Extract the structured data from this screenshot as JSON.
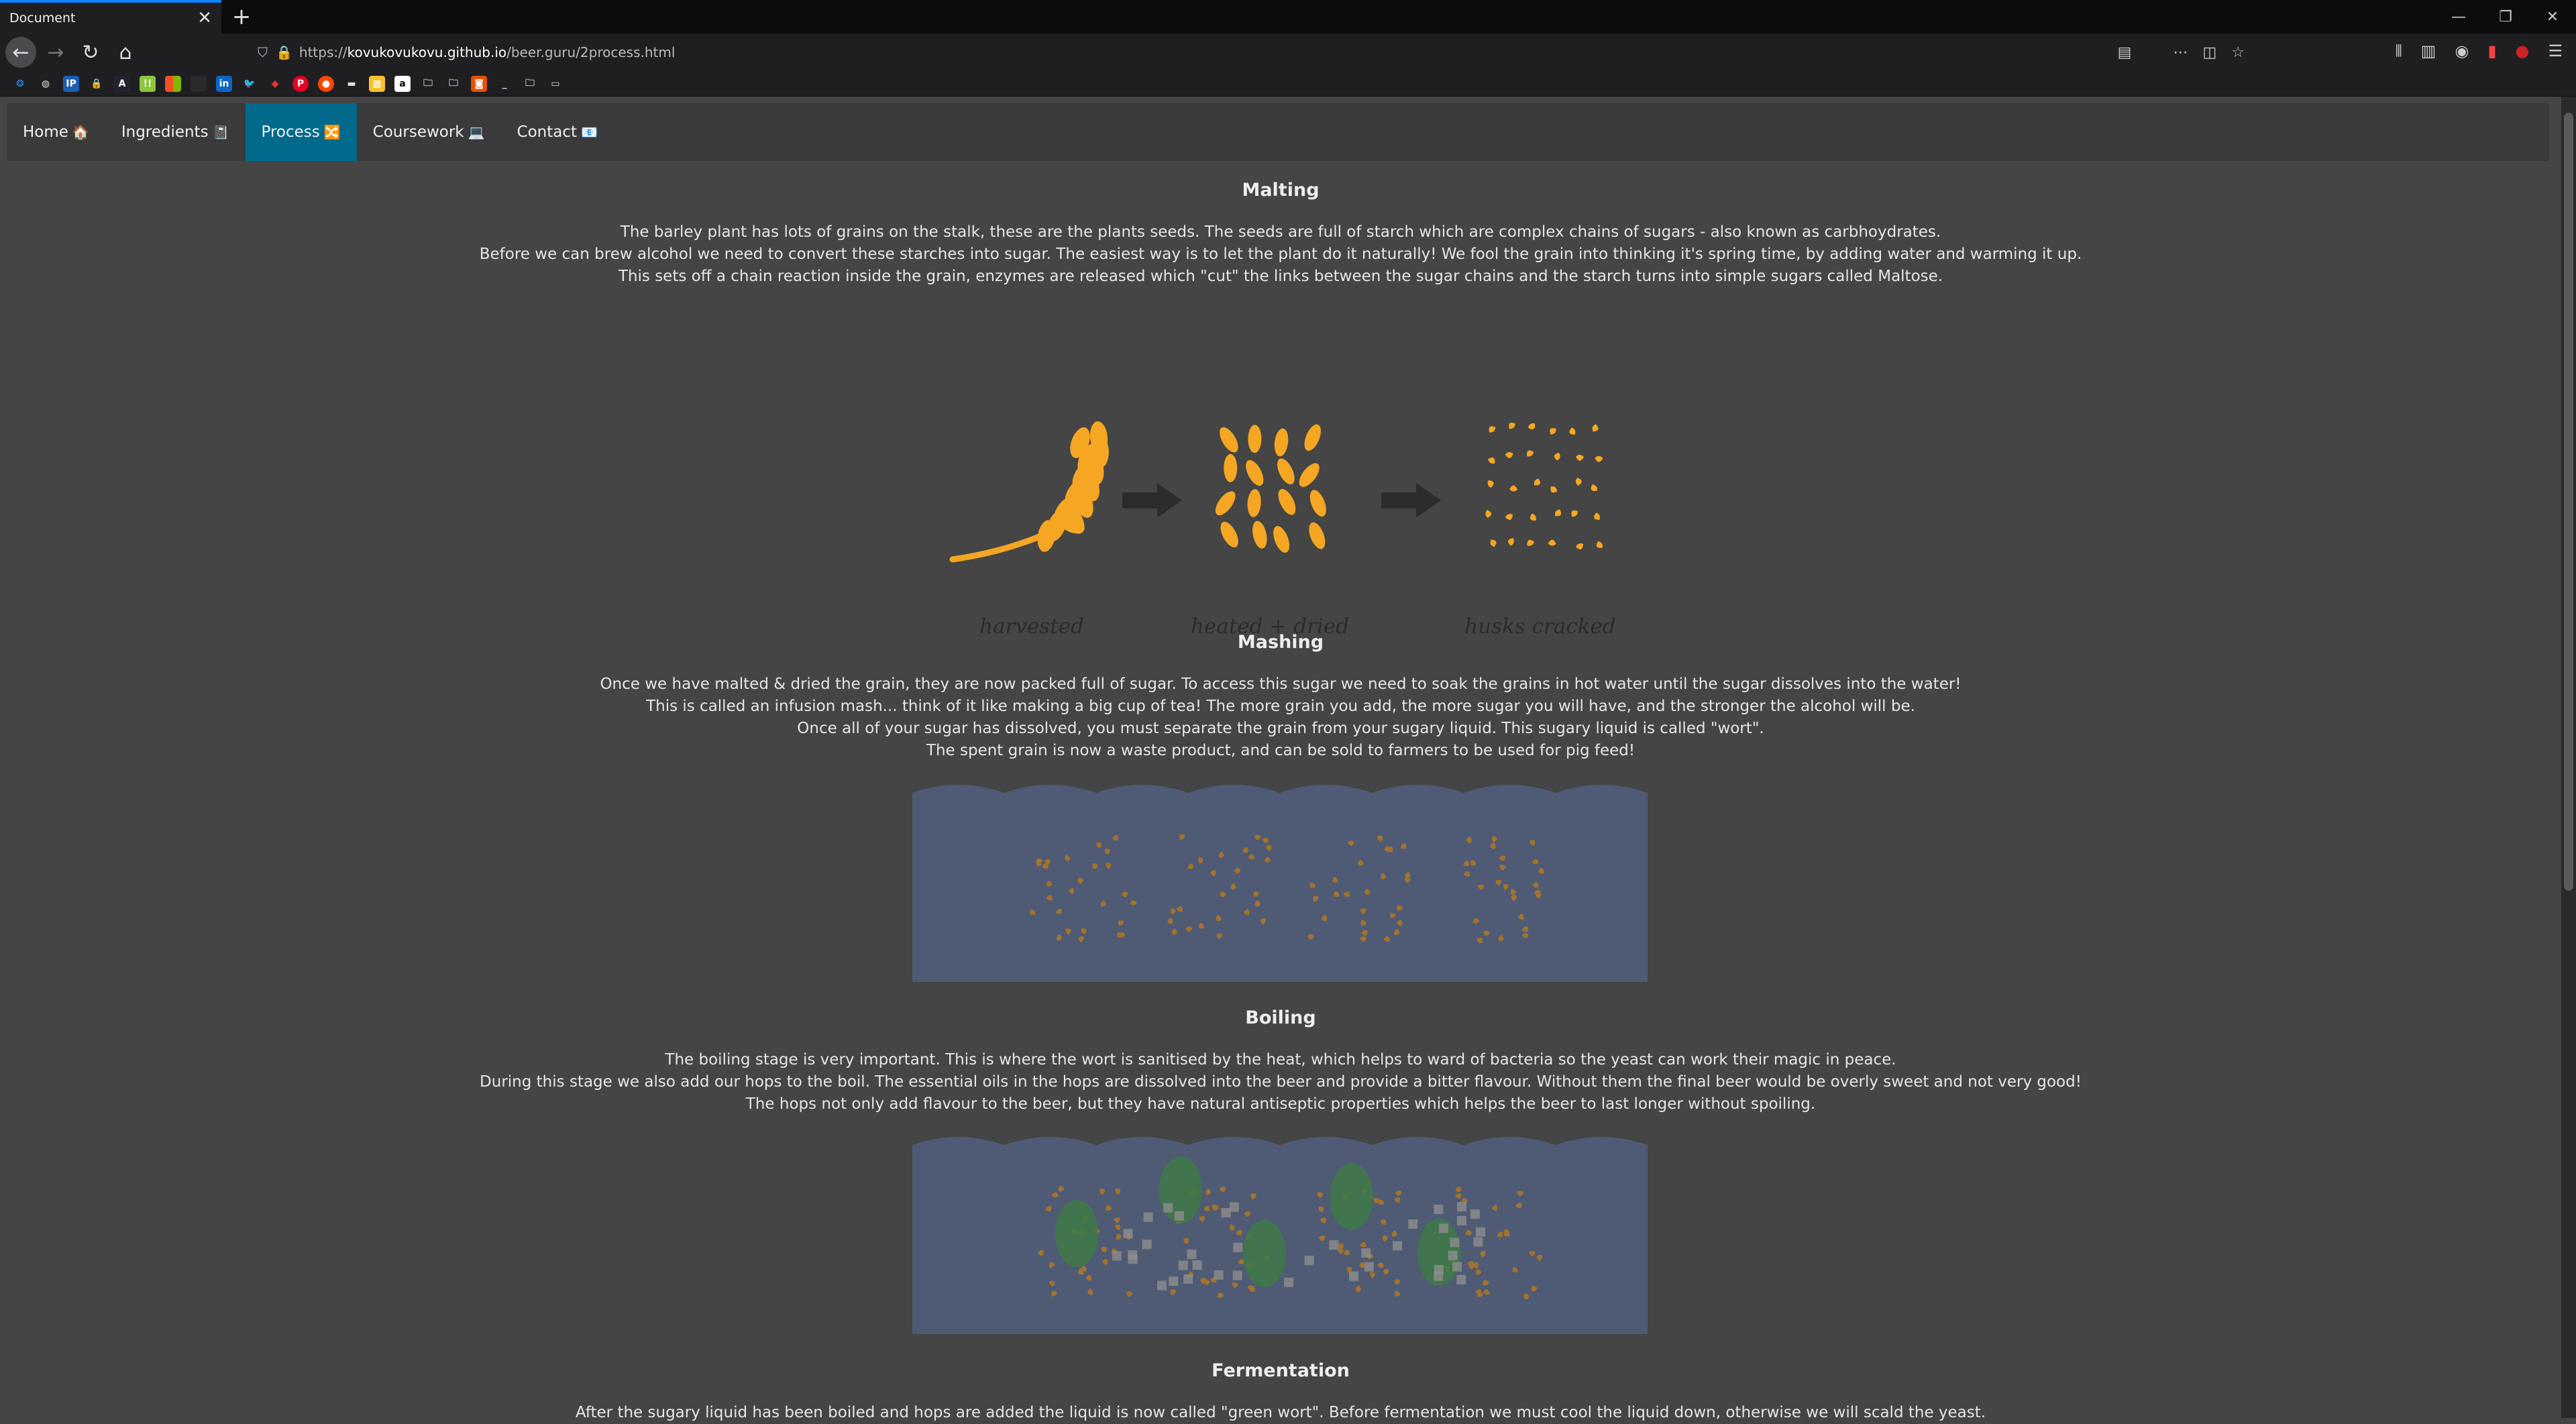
{
  "browser": {
    "tab_title": "Document",
    "url_prefix": "https://",
    "url_domain": "kovukovukovu.github.io",
    "url_path": "/beer.guru/2process.html"
  },
  "site_nav": {
    "items": [
      {
        "label": "Home",
        "emoji": "🏠"
      },
      {
        "label": "Ingredients",
        "emoji": "📓"
      },
      {
        "label": "Process",
        "emoji": "🔀"
      },
      {
        "label": "Coursework",
        "emoji": "💻"
      },
      {
        "label": "Contact",
        "emoji": "📧"
      }
    ],
    "active": "Process"
  },
  "sections": {
    "malting": {
      "title": "Malting",
      "lines": [
        "The barley plant has lots of grains on the stalk, these are the plants seeds. The seeds are full of starch which are complex chains of sugars - also known as carbhoydrates.",
        "Before we can brew alcohol we need to convert these starches into sugar. The easiest way is to let the plant do it naturally! We fool the grain into thinking it's spring time, by adding water and warming it up.",
        "This sets off a chain reaction inside the grain, enzymes are released which \"cut\" the links between the sugar chains and the starch turns into simple sugars called Maltose."
      ],
      "captions": [
        "harvested",
        "heated + dried",
        "husks cracked"
      ]
    },
    "mashing": {
      "title": "Mashing",
      "lines": [
        "Once we have malted & dried the grain, they are now packed full of sugar. To access this sugar we need to soak the grains in hot water until the sugar dissolves into the water!",
        "This is called an infusion mash... think of it like making a big cup of tea! The more grain you add, the more sugar you will have, and the stronger the alcohol will be.",
        "Once all of your sugar has dissolved, you must separate the grain from your sugary liquid. This sugary liquid is called \"wort\".",
        "The spent grain is now a waste product, and can be sold to farmers to be used for pig feed!"
      ]
    },
    "boiling": {
      "title": "Boiling",
      "lines": [
        "The boiling stage is very important. This is where the wort is sanitised by the heat, which helps to ward of bacteria so the yeast can work their magic in peace.",
        "During this stage we also add our hops to the boil. The essential oils in the hops are dissolved into the beer and provide a bitter flavour. Without them the final beer would be overly sweet and not very good!",
        "The hops not only add flavour to the beer, but they have natural antiseptic properties which helps the beer to last longer without spoiling."
      ]
    },
    "fermentation": {
      "title": "Fermentation",
      "lines": [
        "After the sugary liquid has been boiled and hops are added the liquid is now called \"green wort\". Before fermentation we must cool the liquid down, otherwise we will scald the yeast."
      ]
    }
  },
  "colors": {
    "page_bg": "#444544",
    "nav_bg": "#3a3a3a",
    "nav_active": "#00698c",
    "grain": "#f5a623",
    "vat": "#4f5b75",
    "hops": "#3d7a48"
  }
}
